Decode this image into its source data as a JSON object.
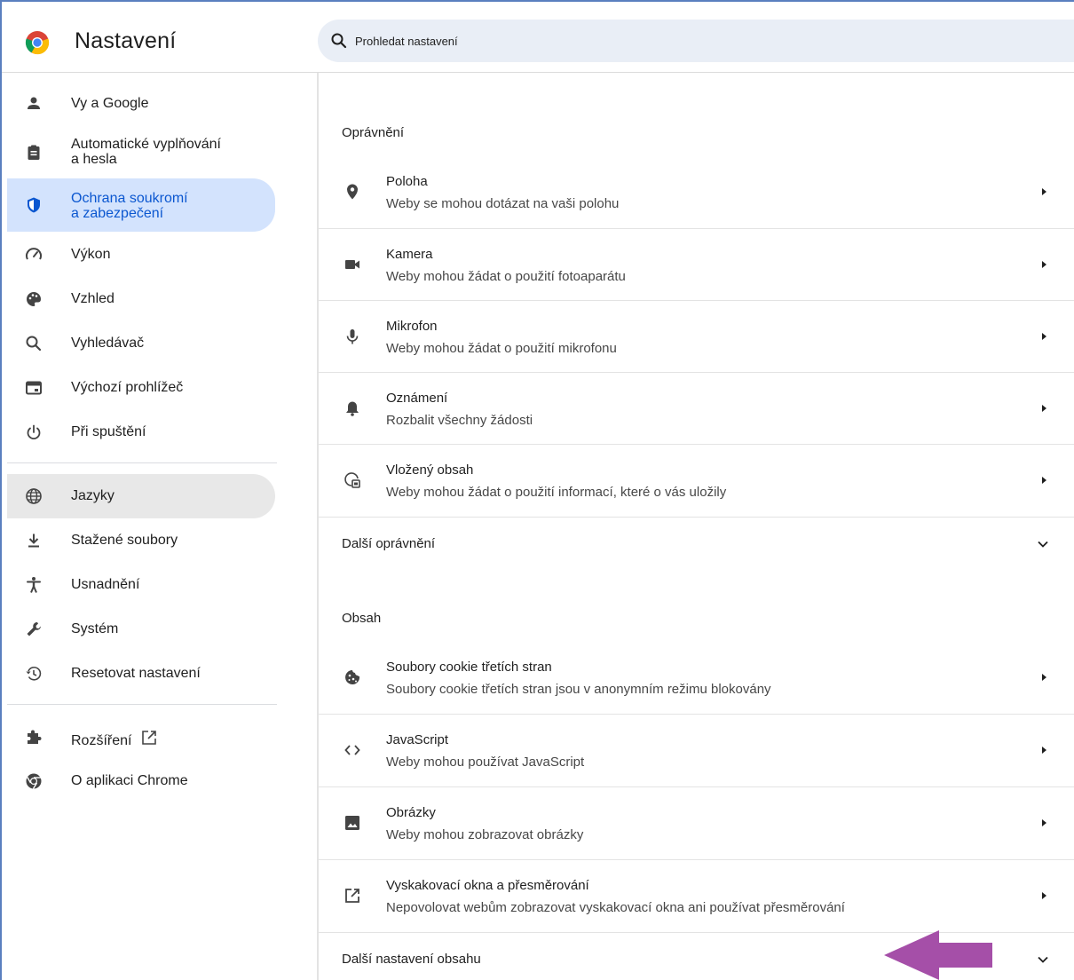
{
  "header": {
    "title": "Nastavení",
    "search_placeholder": "Prohledat nastavení"
  },
  "sidebar": {
    "items": [
      {
        "label": "Vy a Google",
        "icon": "person-icon"
      },
      {
        "label": "Automatické vyplňování",
        "label2": "a hesla",
        "icon": "clipboard-icon"
      },
      {
        "label": "Ochrana soukromí",
        "label2": "a zabezpečení",
        "icon": "shield-icon"
      },
      {
        "label": "Výkon",
        "icon": "speedometer-icon"
      },
      {
        "label": "Vzhled",
        "icon": "palette-icon"
      },
      {
        "label": "Vyhledávač",
        "icon": "search-icon"
      },
      {
        "label": "Výchozí prohlížeč",
        "icon": "browser-icon"
      },
      {
        "label": "Při spuštění",
        "icon": "power-icon"
      },
      {
        "label": "Jazyky",
        "icon": "globe-icon"
      },
      {
        "label": "Stažené soubory",
        "icon": "download-icon"
      },
      {
        "label": "Usnadnění",
        "icon": "accessibility-icon"
      },
      {
        "label": "Systém",
        "icon": "wrench-icon"
      },
      {
        "label": "Resetovat nastavení",
        "icon": "history-icon"
      },
      {
        "label": "Rozšíření",
        "icon": "puzzle-icon"
      },
      {
        "label": "O aplikaci Chrome",
        "icon": "chrome-icon"
      }
    ]
  },
  "main": {
    "permissions": {
      "title": "Oprávnění",
      "rows": [
        {
          "title": "Poloha",
          "subtitle": "Weby se mohou dotázat na vaši polohu",
          "icon": "location-icon"
        },
        {
          "title": "Kamera",
          "subtitle": "Weby mohou žádat o použití fotoaparátu",
          "icon": "camera-icon"
        },
        {
          "title": "Mikrofon",
          "subtitle": "Weby mohou žádat o použití mikrofonu",
          "icon": "microphone-icon"
        },
        {
          "title": "Oznámení",
          "subtitle": "Rozbalit všechny žádosti",
          "icon": "bell-icon"
        },
        {
          "title": "Vložený obsah",
          "subtitle": "Weby mohou žádat o použití informací, které o vás uložily",
          "icon": "embedded-content-icon"
        }
      ],
      "more_label": "Další oprávnění"
    },
    "content": {
      "title": "Obsah",
      "rows": [
        {
          "title": "Soubory cookie třetích stran",
          "subtitle": "Soubory cookie třetích stran jsou v anonymním režimu blokovány",
          "icon": "cookie-icon"
        },
        {
          "title": "JavaScript",
          "subtitle": "Weby mohou používat JavaScript",
          "icon": "code-icon"
        },
        {
          "title": "Obrázky",
          "subtitle": "Weby mohou zobrazovat obrázky",
          "icon": "image-icon"
        },
        {
          "title": "Vyskakovací okna a přesměrování",
          "subtitle": "Nepovolovat webům zobrazovat vyskakovací okna ani používat přesměrování",
          "icon": "popup-icon"
        }
      ],
      "more_label": "Další nastavení obsahu"
    }
  },
  "colors": {
    "accent": "#0b57d0",
    "selected_bg": "#d3e3fd",
    "annotation_arrow": "#a54fa8"
  }
}
